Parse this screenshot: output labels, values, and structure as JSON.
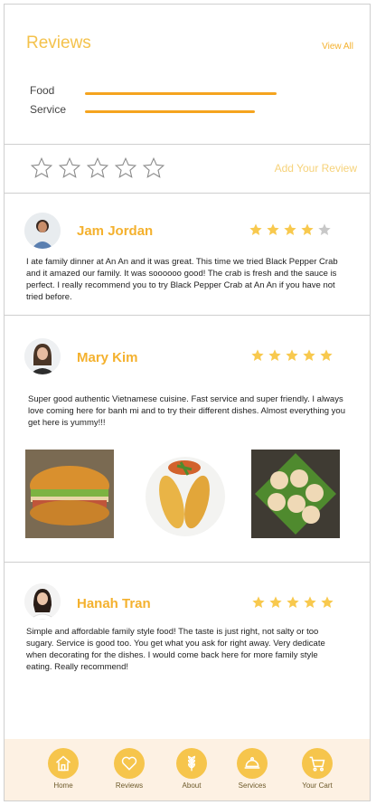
{
  "summary": {
    "title": "Reviews",
    "view_all": "View All",
    "categories": [
      {
        "label": "Food"
      },
      {
        "label": "Service"
      }
    ],
    "add_review": "Add Your Review"
  },
  "reviews": [
    {
      "name": "Jam Jordan",
      "rating": 4,
      "text": "I ate family dinner at An An and it was great. This time we tried Black Pepper Crab and it amazed our family. It was soooooo good! The crab is fresh and the sauce is perfect. I really recommend you to try Black Pepper Crab at An An if you have not tried before."
    },
    {
      "name": "Mary Kim",
      "rating": 5,
      "text": "Super good authentic Vietnamese cuisine. Fast service and super friendly. I always love coming here for banh mi and to try their different dishes. Almost everything you get here is yummy!!!",
      "photos": [
        "banh-mi-photo",
        "grilled-lobster-photo",
        "scallops-on-leaves-photo"
      ]
    },
    {
      "name": "Hanah Tran",
      "rating": 5,
      "text": "Simple and affordable family style food! The taste is just right, not salty or too sugary. Service is good too. You get what you ask for right away. Very dedicate when decorating for the dishes. I would come back here for more family style eating. Really recommend!"
    }
  ],
  "nav": [
    {
      "label": "Home",
      "icon": "home-icon"
    },
    {
      "label": "Reviews",
      "icon": "heart-icon"
    },
    {
      "label": "About",
      "icon": "wheat-icon"
    },
    {
      "label": "Services",
      "icon": "cloche-icon"
    },
    {
      "label": "Your Cart",
      "icon": "cart-icon"
    }
  ],
  "colors": {
    "accent": "#f4b12e",
    "star": "#f8c94e",
    "star_empty": "#c8c8c8",
    "nav_bg": "#fdf1e3"
  }
}
